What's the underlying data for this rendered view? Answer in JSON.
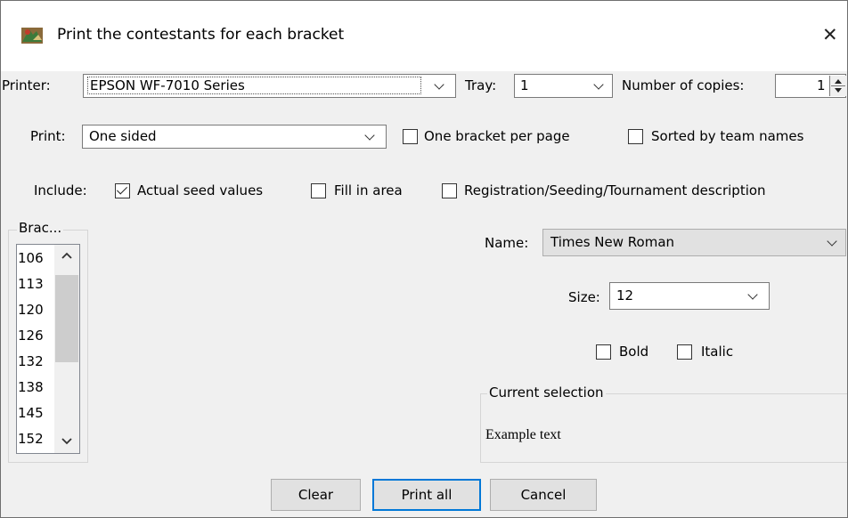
{
  "window": {
    "title": "Print the contestants for each bracket",
    "close_label": "✕"
  },
  "printer": {
    "label": "Printer:",
    "value": "EPSON WF-7010 Series"
  },
  "tray": {
    "label": "Tray:",
    "value": "1"
  },
  "copies": {
    "label": "Number of copies:",
    "value": "1"
  },
  "print_mode": {
    "label": "Print:",
    "value": "One sided"
  },
  "options": {
    "one_bracket_per_page": {
      "label": "One bracket per page",
      "checked": false
    },
    "sorted_by_team_names": {
      "label": "Sorted by team names",
      "checked": false
    }
  },
  "include": {
    "label": "Include:",
    "actual_seed_values": {
      "label": "Actual seed values",
      "checked": true
    },
    "fill_in_area": {
      "label": "Fill in area",
      "checked": false
    },
    "registration": {
      "label": "Registration/Seeding/Tournament description",
      "checked": false
    }
  },
  "brackets": {
    "title": "Brac...",
    "items": [
      "106",
      "113",
      "120",
      "126",
      "132",
      "138",
      "145",
      "152"
    ]
  },
  "font": {
    "name_label": "Name:",
    "name_value": "Times New Roman",
    "size_label": "Size:",
    "size_value": "12",
    "bold": {
      "label": "Bold",
      "checked": false
    },
    "italic": {
      "label": "Italic",
      "checked": false
    }
  },
  "current_selection": {
    "title": "Current selection",
    "sample": "Example text"
  },
  "buttons": {
    "clear": "Clear",
    "print_all": "Print all",
    "cancel": "Cancel"
  }
}
